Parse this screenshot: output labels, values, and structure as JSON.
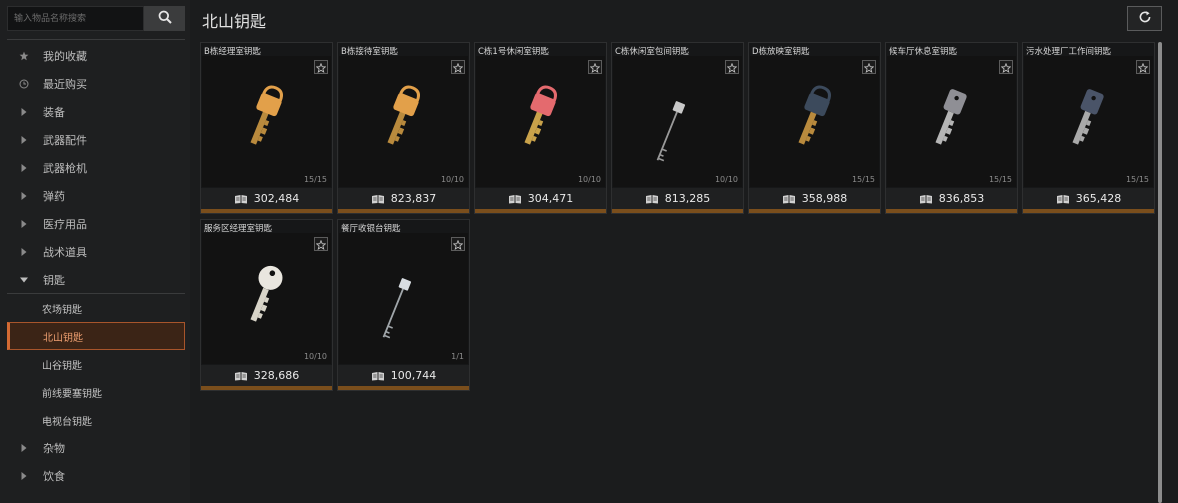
{
  "search": {
    "placeholder": "输入物品名称搜索"
  },
  "sidebar": {
    "items": [
      {
        "label": "我的收藏",
        "icon": "star-icon"
      },
      {
        "label": "最近购买",
        "icon": "clock-icon"
      },
      {
        "label": "装备",
        "icon": "caret-right-icon"
      },
      {
        "label": "武器配件",
        "icon": "caret-right-icon"
      },
      {
        "label": "武器枪机",
        "icon": "caret-right-icon"
      },
      {
        "label": "弹药",
        "icon": "caret-right-icon"
      },
      {
        "label": "医疗用品",
        "icon": "caret-right-icon"
      },
      {
        "label": "战术道具",
        "icon": "caret-right-icon"
      },
      {
        "label": "钥匙",
        "icon": "caret-down-icon"
      }
    ],
    "sub_items": [
      "农场钥匙",
      "北山钥匙",
      "山谷钥匙",
      "前线要塞钥匙",
      "电视台钥匙"
    ],
    "active_sub": "北山钥匙",
    "after_items": [
      {
        "label": "杂物",
        "icon": "caret-right-icon"
      },
      {
        "label": "饮食",
        "icon": "caret-right-icon"
      }
    ]
  },
  "header": {
    "title": "北山钥匙"
  },
  "items": [
    {
      "name": "B栋经理室钥匙",
      "price": "302,484",
      "qty": "15/15",
      "head": "#e2a04a",
      "head_shape": "padlock",
      "shaft": "#b98a3d"
    },
    {
      "name": "B栋接待室钥匙",
      "price": "823,837",
      "qty": "10/10",
      "head": "#e2a04a",
      "head_shape": "padlock",
      "shaft": "#b98a3d"
    },
    {
      "name": "C栋1号休闲室钥匙",
      "price": "304,471",
      "qty": "10/10",
      "head": "#e46a6e",
      "head_shape": "padlock",
      "shaft": "#c9a24a"
    },
    {
      "name": "C栋休闲室包间钥匙",
      "price": "813,285",
      "qty": "10/10",
      "head": "#c9c9c9",
      "head_shape": "skeleton",
      "shaft": "#9a9a9a"
    },
    {
      "name": "D栋放映室钥匙",
      "price": "358,988",
      "qty": "15/15",
      "head": "#3c4a5c",
      "head_shape": "padlock",
      "shaft": "#b98a3d"
    },
    {
      "name": "候车厅休息室钥匙",
      "price": "836,853",
      "qty": "15/15",
      "head": "#8f8f95",
      "head_shape": "square",
      "shaft": "#b5b5b5"
    },
    {
      "name": "污水处理厂工作间钥匙",
      "price": "365,428",
      "qty": "15/15",
      "head": "#4a5468",
      "head_shape": "square",
      "shaft": "#a9a9a9"
    },
    {
      "name": "服务区经理室钥匙",
      "price": "328,686",
      "qty": "10/10",
      "head": "#e9e6df",
      "head_shape": "round",
      "shaft": "#d8d4c8"
    },
    {
      "name": "餐厅收银台钥匙",
      "price": "100,744",
      "qty": "1/1",
      "head": "#d8dde2",
      "head_shape": "skeleton",
      "shaft": "#a0a6aa"
    }
  ],
  "colors": {
    "accent": "#d36a33",
    "card_bar": "#7a4e1c",
    "background": "#1b1c1d"
  }
}
